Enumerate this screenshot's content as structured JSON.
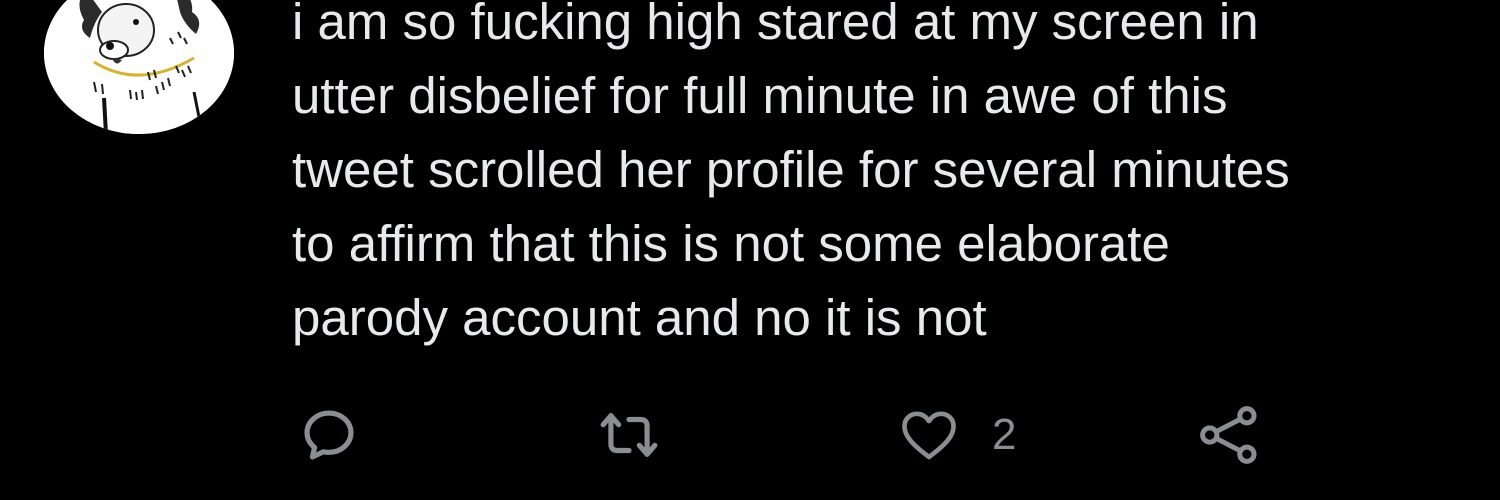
{
  "tweet": {
    "text_lines": [
      "i am so fucking high stared at my screen in",
      "utter disbelief for full minute in awe of this",
      "tweet scrolled her profile for several minutes",
      "to affirm that this is not some elaborate",
      "parody account and no it is not"
    ],
    "avatar": "dog-avatar"
  },
  "actions": {
    "reply": {
      "icon": "reply-icon"
    },
    "retweet": {
      "icon": "retweet-icon"
    },
    "like": {
      "icon": "heart-icon",
      "count": "2"
    },
    "share": {
      "icon": "share-icon"
    }
  },
  "colors": {
    "background": "#000000",
    "text": "#e7e9ea",
    "icon": "#8a8d91"
  }
}
